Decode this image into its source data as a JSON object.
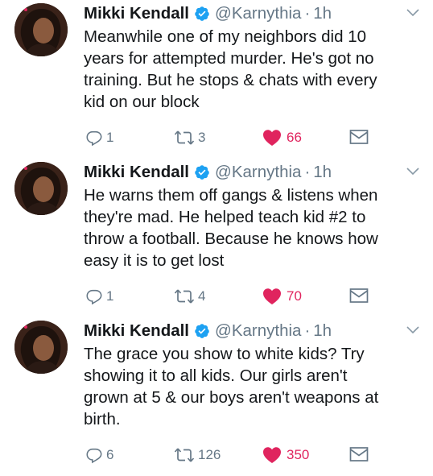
{
  "author": {
    "name": "Mikki Kendall",
    "handle": "@Karnythia",
    "separator": "·"
  },
  "tweets": [
    {
      "time": "1h",
      "text": "Meanwhile one of my neighbors did 10\nyears for attempted murder. He's got no\ntraining. But he stops & chats with every\nkid on our block",
      "replies": "1",
      "retweets": "3",
      "likes": "66"
    },
    {
      "time": "1h",
      "text": "He warns them off gangs & listens when\nthey're mad. He helped teach kid #2 to\nthrow a football. Because he knows how\neasy it is to get lost",
      "replies": "1",
      "retweets": "4",
      "likes": "70"
    },
    {
      "time": "1h",
      "text": "The grace you show to white kids? Try\nshowing it to all kids. Our girls aren't\ngrown at 5 & our boys aren't weapons at\nbirth.",
      "replies": "6",
      "retweets": "126",
      "likes": "350"
    }
  ],
  "colors": {
    "verified": "#1da1f2",
    "like": "#e0245e",
    "muted": "#657786",
    "text": "#14171a"
  },
  "icons": [
    "avatar",
    "verified-badge-icon",
    "chevron-down-icon",
    "reply-icon",
    "retweet-icon",
    "heart-icon",
    "mail-icon"
  ]
}
